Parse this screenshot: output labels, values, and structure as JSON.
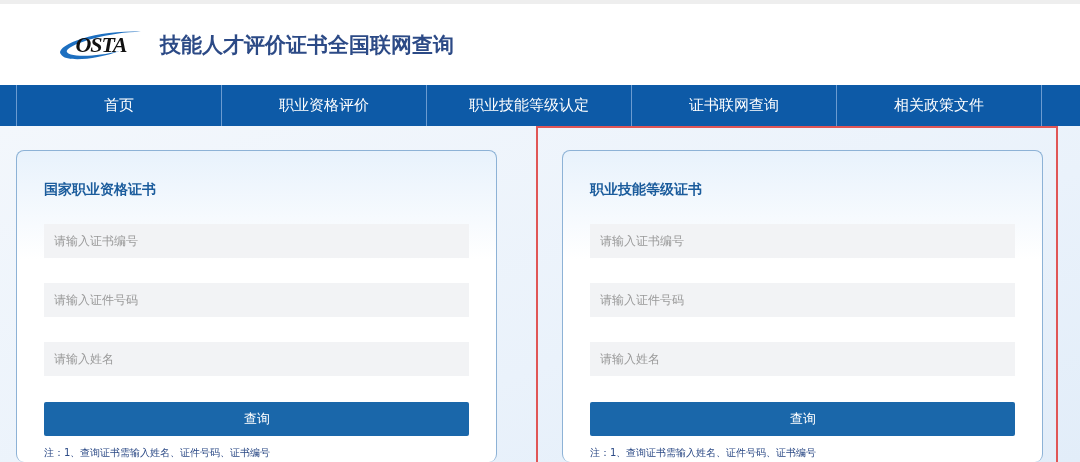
{
  "header": {
    "logo_text": "OSTA",
    "title": "技能人才评价证书全国联网查询"
  },
  "nav": [
    {
      "label": "首页"
    },
    {
      "label": "职业资格评价"
    },
    {
      "label": "职业技能等级认定"
    },
    {
      "label": "证书联网查询"
    },
    {
      "label": "相关政策文件"
    }
  ],
  "cards": [
    {
      "title": "国家职业资格证书",
      "highlighted": false,
      "fields": [
        {
          "placeholder": "请输入证书编号"
        },
        {
          "placeholder": "请输入证件号码"
        },
        {
          "placeholder": "请输入姓名"
        }
      ],
      "button": "查询",
      "note": "注：1、查询证书需输入姓名、证件号码、证书编号"
    },
    {
      "title": "职业技能等级证书",
      "highlighted": true,
      "fields": [
        {
          "placeholder": "请输入证书编号"
        },
        {
          "placeholder": "请输入证件号码"
        },
        {
          "placeholder": "请输入姓名"
        }
      ],
      "button": "查询",
      "note": "注：1、查询证书需输入姓名、证件号码、证书编号"
    }
  ]
}
